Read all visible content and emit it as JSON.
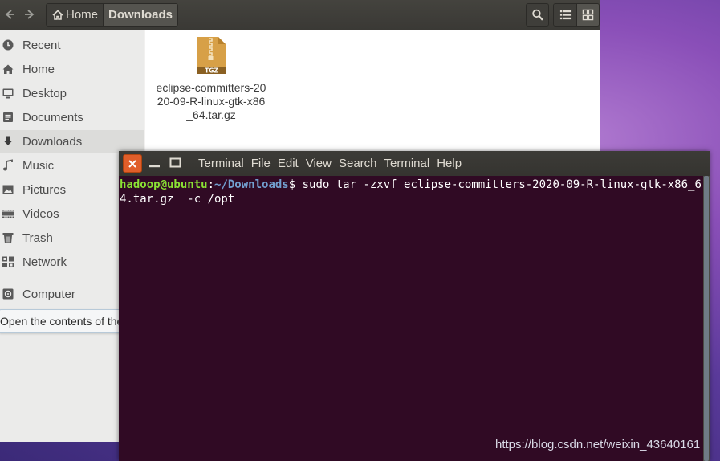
{
  "file_manager": {
    "nav": {
      "back_icon": "arrow-left-icon",
      "forward_icon": "arrow-right-icon"
    },
    "breadcrumbs": [
      {
        "label": "Home",
        "icon": "home-icon"
      },
      {
        "label": "Downloads"
      }
    ],
    "toolbar": {
      "search_icon": "search-icon",
      "list_view_icon": "list-icon",
      "grid_view_icon": "grid-icon"
    },
    "sidebar": {
      "items": [
        {
          "label": "Recent",
          "icon": "clock-icon"
        },
        {
          "label": "Home",
          "icon": "home-icon"
        },
        {
          "label": "Desktop",
          "icon": "desktop-icon"
        },
        {
          "label": "Documents",
          "icon": "document-icon"
        },
        {
          "label": "Downloads",
          "icon": "download-icon",
          "selected": true
        },
        {
          "label": "Music",
          "icon": "music-icon"
        },
        {
          "label": "Pictures",
          "icon": "picture-icon"
        },
        {
          "label": "Videos",
          "icon": "video-icon"
        },
        {
          "label": "Trash",
          "icon": "trash-icon"
        },
        {
          "label": "Network",
          "icon": "network-icon"
        },
        {
          "label": "Computer",
          "icon": "computer-icon"
        }
      ]
    },
    "files": [
      {
        "name": "eclipse-committers-2020-09-R-linux-gtk-x86_64.tar.gz",
        "icon_label": "TGZ"
      }
    ],
    "tooltip": "Open the contents of the file system"
  },
  "terminal": {
    "menu": [
      "Terminal",
      "File",
      "Edit",
      "View",
      "Search",
      "Terminal",
      "Help"
    ],
    "prompt_user": "hadoop@ubuntu",
    "prompt_sep": ":",
    "prompt_path": "~/Downloads",
    "prompt_symbol": "$ ",
    "command": "sudo tar -zxvf eclipse-committers-2020-09-R-linux-gtk-x86_64.tar.gz  -c /opt"
  },
  "watermark": "https://blog.csdn.net/weixin_43640161",
  "colors": {
    "close_button": "#e05e2a",
    "terminal_bg": "#300a24",
    "prompt_user": "#8ae234",
    "prompt_path": "#729fcf"
  }
}
